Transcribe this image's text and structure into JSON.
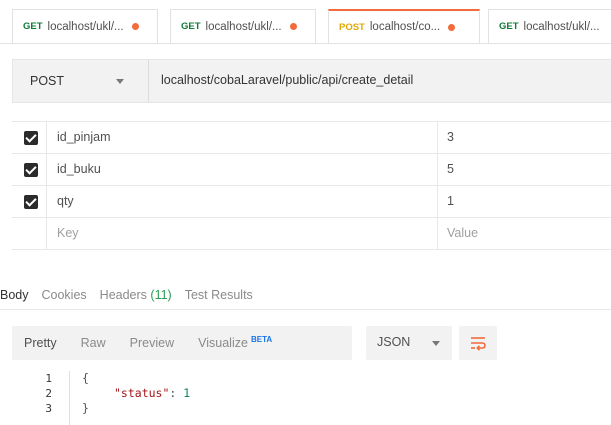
{
  "tabs": [
    {
      "method": "GET",
      "url": "localhost/ukl/...",
      "modified": true,
      "active": false
    },
    {
      "method": "GET",
      "url": "localhost/ukl/...",
      "modified": true,
      "active": false
    },
    {
      "method": "POST",
      "url": "localhost/co...",
      "modified": true,
      "active": true
    },
    {
      "method": "GET",
      "url": "localhost/ukl/...",
      "modified": false,
      "active": false
    }
  ],
  "request": {
    "method": "POST",
    "url": "localhost/cobaLaravel/public/api/create_detail"
  },
  "params": {
    "rows": [
      {
        "key": "id_pinjam",
        "value": "3",
        "checked": true
      },
      {
        "key": "id_buku",
        "value": "5",
        "checked": true
      },
      {
        "key": "qty",
        "value": "1",
        "checked": true
      }
    ],
    "placeholder": {
      "key": "Key",
      "value": "Value"
    }
  },
  "response": {
    "tabs": {
      "body": "Body",
      "cookies": "Cookies",
      "headers": "Headers",
      "headers_count": "(11)",
      "test_results": "Test Results"
    },
    "toolbar": {
      "pretty": "Pretty",
      "raw": "Raw",
      "preview": "Preview",
      "visualize": "Visualize",
      "beta": "BETA",
      "format": "JSON"
    },
    "code": {
      "line_numbers": [
        "1",
        "2",
        "3"
      ],
      "open_brace": "{",
      "key": "\"status\"",
      "colon": ": ",
      "value": "1",
      "close_brace": "}"
    }
  },
  "colors": {
    "accent": "#f26b3a",
    "get_method": "#0f7a3a",
    "post_method": "#e0a800",
    "count_green": "#2a9d55"
  }
}
